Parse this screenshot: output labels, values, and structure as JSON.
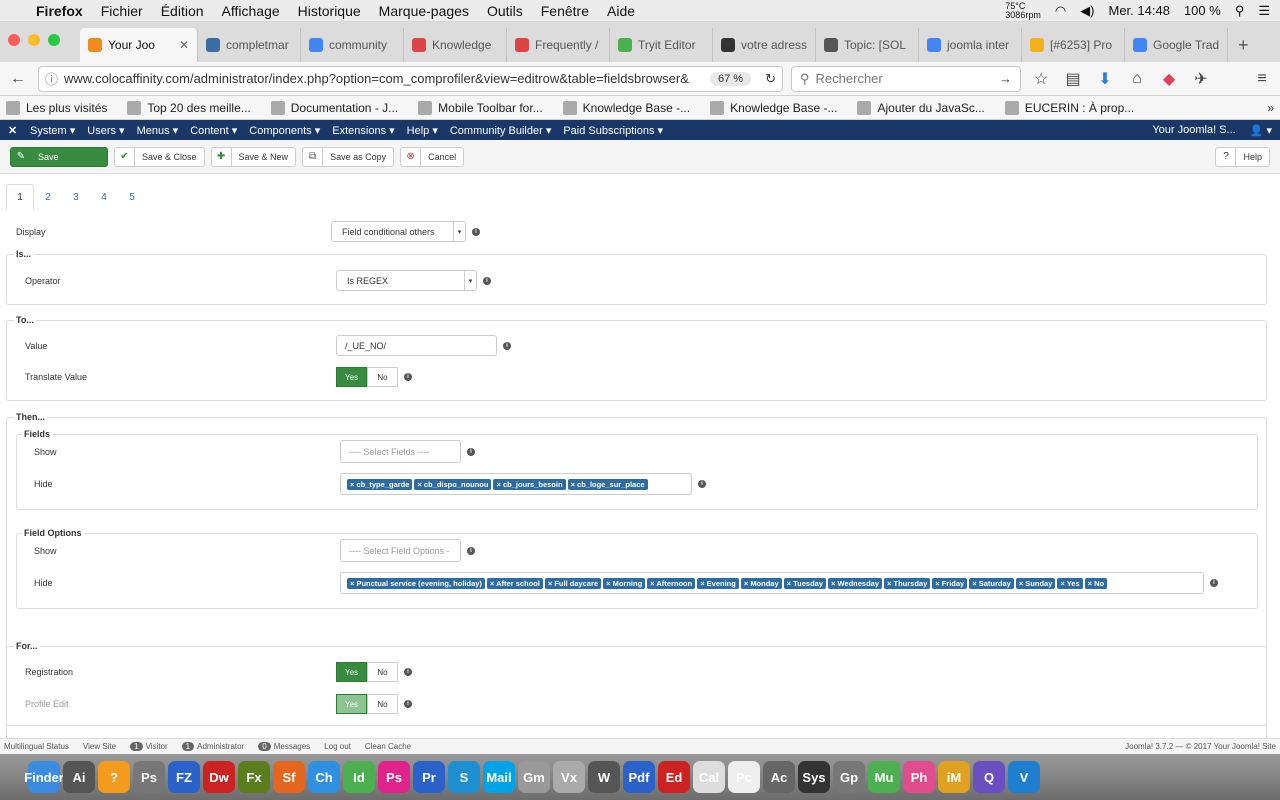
{
  "mac_menu": {
    "apple": "",
    "app": "Firefox",
    "items": [
      "Fichier",
      "Édition",
      "Affichage",
      "Historique",
      "Marque-pages",
      "Outils",
      "Fenêtre",
      "Aide"
    ],
    "temp": "75°C",
    "rpm": "3086rpm",
    "clock": "Mer. 14:48",
    "battery": "100 %"
  },
  "tabs": [
    {
      "label": "Your Joo",
      "active": true,
      "color": "#f28c1e"
    },
    {
      "label": "completmar",
      "color": "#3a6ea5"
    },
    {
      "label": "community",
      "color": "#4285f4"
    },
    {
      "label": "Knowledge",
      "color": "#d44"
    },
    {
      "label": "Frequently /",
      "color": "#d44"
    },
    {
      "label": "Tryit Editor",
      "color": "#4caf50"
    },
    {
      "label": "votre adress",
      "color": "#333"
    },
    {
      "label": "Topic: [SOL",
      "color": "#555"
    },
    {
      "label": "joomla inter",
      "color": "#4285f4"
    },
    {
      "label": "[#6253] Pro",
      "color": "#f2b21e"
    },
    {
      "label": "Google Trad",
      "color": "#4285f4"
    }
  ],
  "url": "www.colocaffinity.com/administrator/index.php?option=com_comprofiler&view=editrow&table=fieldsbrowser&",
  "zoom": "67 %",
  "search_placeholder": "Rechercher",
  "bookmarks": [
    "Les plus visités",
    "Top 20 des meille...",
    "Documentation - J...",
    "Mobile Toolbar for...",
    "Knowledge Base -...",
    "Knowledge Base -...",
    "Ajouter du JavaSc...",
    "EUCERIN : À prop..."
  ],
  "jmenu": {
    "items": [
      "System",
      "Users",
      "Menus",
      "Content",
      "Components",
      "Extensions",
      "Help",
      "Community Builder",
      "Paid Subscriptions"
    ],
    "site": "Your Joomla! S..."
  },
  "toolbar": {
    "save": "Save",
    "save_close": "Save & Close",
    "save_new": "Save & New",
    "save_copy": "Save as Copy",
    "cancel": "Cancel",
    "help": "Help"
  },
  "page_tabs": [
    "1",
    "2",
    "3",
    "4",
    "5"
  ],
  "form": {
    "display_label": "Display",
    "display_value": "Field conditional others",
    "is_legend": "Is...",
    "operator_label": "Operator",
    "operator_value": "Is REGEX",
    "to_legend": "To...",
    "value_label": "Value",
    "value_value": "/_UE_NO/",
    "translate_label": "Translate Value",
    "yes": "Yes",
    "no": "No",
    "then_legend": "Then...",
    "fields_legend": "Fields",
    "show_label": "Show",
    "hide_label": "Hide",
    "select_fields_ph": "---- Select Fields ----",
    "hide_fields": [
      "cb_type_garde",
      "cb_dispo_nounou",
      "cb_jours_besoin",
      "cb_loge_sur_place"
    ],
    "field_options_legend": "Field Options",
    "select_options_ph": "---- Select Field Options -",
    "hide_options": [
      "Punctual service (evening, holiday)",
      "After school",
      "Full daycare",
      "Morning",
      "Afternoon",
      "Evening",
      "Monday",
      "Tuesday",
      "Wednesday",
      "Thursday",
      "Friday",
      "Saturday",
      "Sunday",
      "Yes",
      "No"
    ],
    "for_legend": "For...",
    "registration_label": "Registration",
    "profile_edit_label": "Profile Edit"
  },
  "status": {
    "multilingual": "Multilingual Status",
    "view_site": "View Site",
    "visitor_count": "1",
    "visitor": "Visitor",
    "admin_count": "1",
    "admin": "Administrator",
    "msg_count": "0",
    "messages": "Messages",
    "logout": "Log out",
    "clean": "Clean Cache",
    "footer": "Joomla! 3.7.2  —  © 2017 Your Joomla! Site"
  },
  "dock": [
    "Finder",
    "Ai",
    "?",
    "Ps",
    "FZ",
    "Dw",
    "Fx",
    "Sf",
    "Ch",
    "Id",
    "Ps",
    "Pr",
    "S",
    "Mail",
    "Gm",
    "Vx",
    "W",
    "Pdf",
    "Ed",
    "Cal",
    "Pc",
    "Ac",
    "Sys",
    "Gp",
    "Mu",
    "Ph",
    "iM",
    "Q",
    "V"
  ]
}
